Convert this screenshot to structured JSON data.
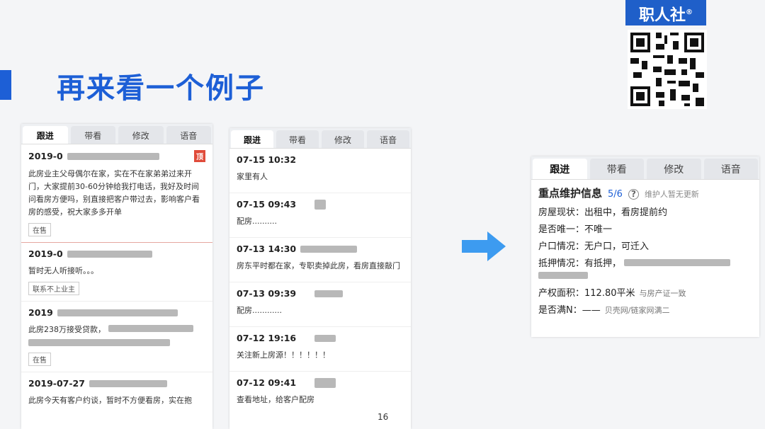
{
  "slide": {
    "title": "再来看一个例子",
    "page_number": "16"
  },
  "brand": {
    "name": "职人社",
    "mark": "®"
  },
  "panel1": {
    "tabs": [
      "跟进",
      "带看",
      "修改",
      "语音"
    ],
    "entries": [
      {
        "date": "2019-0",
        "badge": "顶",
        "text": "此房业主父母偶尔在家，实在不在家弟弟过来开门，大家提前30-60分钟给我打电话，我好及时间问看房方便吗，别直接把客户带过去，影响客户看房的感受，祝大家多多开单",
        "tag": "在售"
      },
      {
        "date": "2019-0",
        "text": "暂时无人听接听。。。",
        "tag": "联系不上业主"
      },
      {
        "date": "2019",
        "text": "此房238万接受贷款，",
        "tag": "在售"
      },
      {
        "date": "2019-07-27",
        "text": "此房今天有客户约谈，暂时不方便看房，实在抱"
      }
    ]
  },
  "panel2": {
    "tabs": [
      "跟进",
      "带看",
      "修改",
      "语音"
    ],
    "entries": [
      {
        "date": "07-15 10:32",
        "text": "家里有人"
      },
      {
        "date": "07-15 09:43",
        "text": "配房.........."
      },
      {
        "date": "07-13 14:30",
        "text": "房东平时都在家，专职卖掉此房，看房直接敲门"
      },
      {
        "date": "07-13 09:39",
        "text": "配房............"
      },
      {
        "date": "07-12 19:16",
        "text": "关注新上房源！！！！！！"
      },
      {
        "date": "07-12 09:41",
        "text": "查看地址，给客户配房"
      }
    ]
  },
  "panel3": {
    "tabs": [
      "跟进",
      "带看",
      "修改",
      "语音"
    ],
    "heading": "重点维护信息",
    "count": "5/6",
    "note": "维护人暂无更新",
    "rows": [
      {
        "label": "房屋现状：",
        "value": "出租中，看房提前约",
        "sub": ""
      },
      {
        "label": "是否唯一：",
        "value": "不唯一",
        "sub": ""
      },
      {
        "label": "户口情况：",
        "value": "无户口，可迁入",
        "sub": ""
      },
      {
        "label": "抵押情况：",
        "value": "有抵押，",
        "sub": ""
      },
      {
        "label": "产权面积：",
        "value": "112.80平米",
        "sub": "与房产证一致"
      },
      {
        "label": "是否满N：",
        "value": "——",
        "sub": "贝壳网/链家网满二"
      }
    ]
  }
}
